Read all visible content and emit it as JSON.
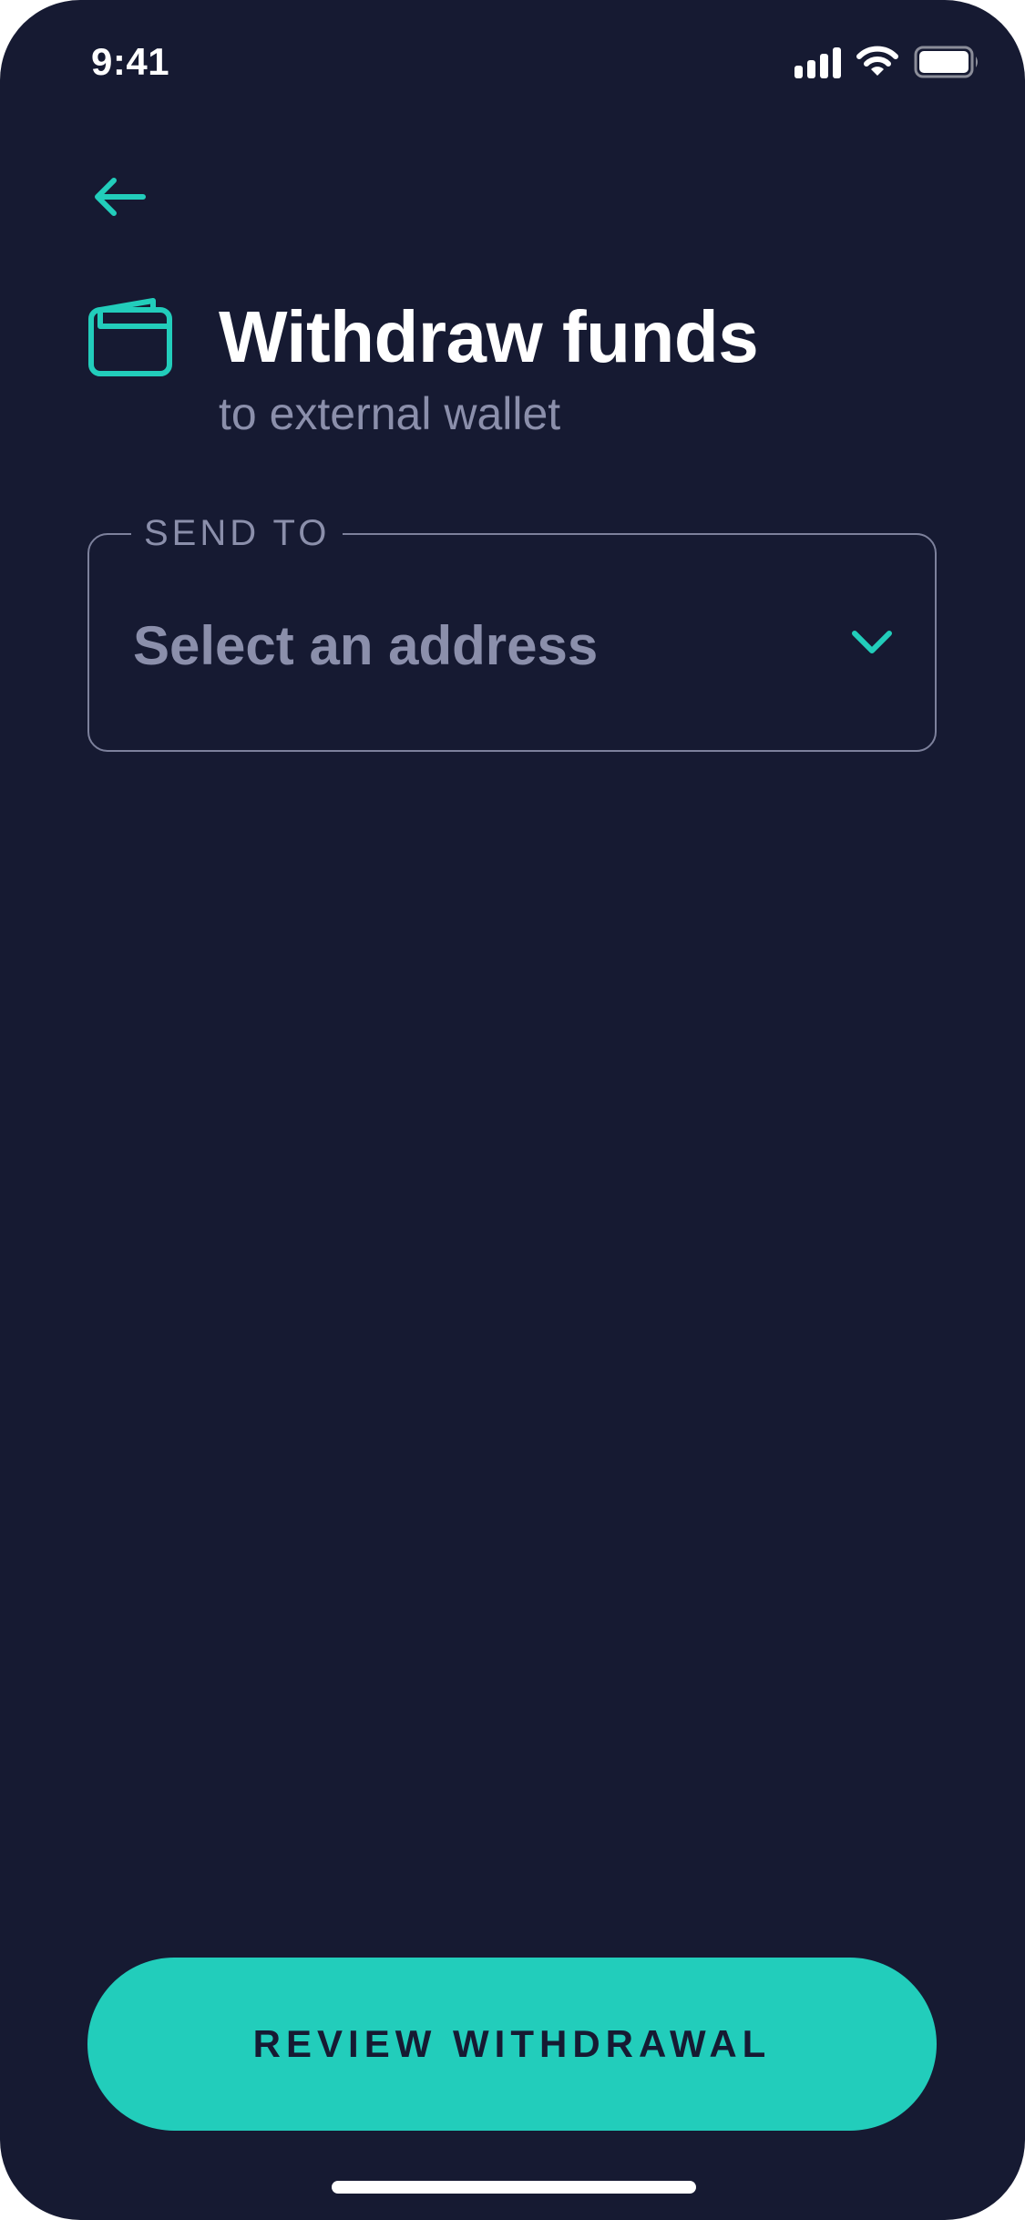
{
  "status_bar": {
    "time": "9:41",
    "icons": [
      "cellular-signal-icon",
      "wifi-icon",
      "battery-icon"
    ]
  },
  "header": {
    "back_icon": "arrow-left-icon",
    "wallet_icon": "wallet-icon",
    "title": "Withdraw funds",
    "subtitle": "to external wallet"
  },
  "send_to": {
    "label": "SEND TO",
    "value": "Select an address",
    "dropdown_icon": "chevron-down-icon"
  },
  "primary_action": {
    "label": "REVIEW WITHDRAWAL"
  },
  "colors": {
    "background": "#161a32",
    "accent": "#22cdbb",
    "text_primary": "#ffffff",
    "text_secondary": "#8b8fab",
    "field_border": "#7d819c"
  }
}
